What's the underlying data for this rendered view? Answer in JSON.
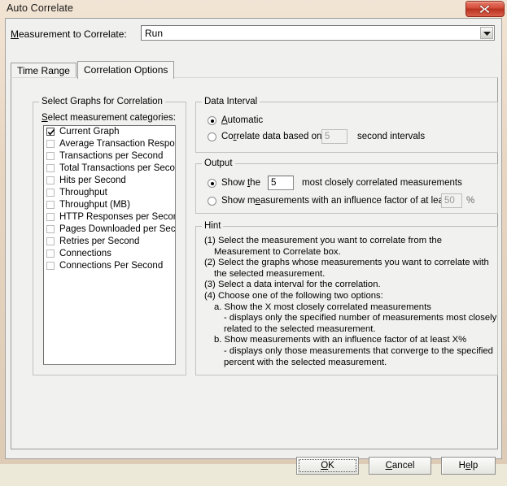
{
  "window": {
    "title": "Auto Correlate",
    "close_label": "X",
    "close_icon": "close-icon"
  },
  "measurement": {
    "label_prefix": "M",
    "label_rest": "easurement to Correlate:",
    "selected_value": "Run",
    "dropdown_icon": "chevron-down-icon"
  },
  "tabs": [
    {
      "label": "Time Range",
      "active": false
    },
    {
      "label": "Correlation Options",
      "active": true
    }
  ],
  "graphs_group": {
    "title": "Select Graphs for Correlation",
    "list_label_prefix": "S",
    "list_label_rest": "elect measurement categories:",
    "items": [
      {
        "label": "Current Graph",
        "checked": true
      },
      {
        "label": "Average Transaction Response Time",
        "checked": false
      },
      {
        "label": "Transactions per Second",
        "checked": false
      },
      {
        "label": "Total Transactions per Second",
        "checked": false
      },
      {
        "label": "Hits per Second",
        "checked": false
      },
      {
        "label": "Throughput",
        "checked": false
      },
      {
        "label": "Throughput (MB)",
        "checked": false
      },
      {
        "label": "HTTP Responses per Second",
        "checked": false
      },
      {
        "label": "Pages Downloaded per Second",
        "checked": false
      },
      {
        "label": "Retries per Second",
        "checked": false
      },
      {
        "label": "Connections",
        "checked": false
      },
      {
        "label": "Connections Per Second",
        "checked": false
      }
    ]
  },
  "data_interval": {
    "title": "Data Interval",
    "option_automatic": {
      "prefix": "A",
      "rest": "utomatic",
      "selected": true
    },
    "option_custom": {
      "prefix": "Co",
      "mnemonic": "r",
      "rest": "relate data based on",
      "selected": false
    },
    "interval_value": "5",
    "interval_suffix": "second intervals"
  },
  "output": {
    "title": "Output",
    "option_show_count": {
      "prefix": "Show ",
      "mnemonic": "t",
      "rest": "he",
      "selected": true
    },
    "count_value": "5",
    "count_suffix": "most closely correlated measurements",
    "option_show_influence": {
      "prefix": "Show m",
      "mnemonic": "e",
      "rest": "asurements with an influence factor of at least",
      "selected": false
    },
    "influence_value": "50",
    "influence_suffix": "%"
  },
  "hint": {
    "title": "Hint",
    "lines": [
      {
        "text": "(1) Select the measurement you want to correlate from the",
        "indent": 0
      },
      {
        "text": "Measurement to Correlate box.",
        "indent": 1
      },
      {
        "text": "(2) Select the graphs whose measurements you want to correlate with",
        "indent": 0
      },
      {
        "text": "the selected measurement.",
        "indent": 1
      },
      {
        "text": "(3) Select a data interval for the correlation.",
        "indent": 0
      },
      {
        "text": "(4) Choose one of the following two options:",
        "indent": 0
      },
      {
        "text": "a. Show the X most closely correlated measurements",
        "indent": 1
      },
      {
        "text": "- displays only the specified number of measurements most closely",
        "indent": 2
      },
      {
        "text": "related to the selected measurement.",
        "indent": 2
      },
      {
        "text": "b. Show measurements with an influence factor of at least X%",
        "indent": 1
      },
      {
        "text": "- displays only those measurements that converge to the specified",
        "indent": 2
      },
      {
        "text": "percent with the selected measurement.",
        "indent": 2
      }
    ]
  },
  "buttons": [
    {
      "prefix": "O",
      "mnemonic": "K",
      "rest": "",
      "name": "ok-button",
      "default": true
    },
    {
      "prefix": "",
      "mnemonic": "C",
      "rest": "ancel",
      "name": "cancel-button",
      "default": false
    },
    {
      "prefix": "H",
      "mnemonic": "e",
      "rest": "lp",
      "name": "help-button",
      "default": false
    }
  ],
  "colors": {
    "close_red": "#b93222",
    "window_chrome": "#e8d6c2",
    "dialog_face": "#f1f1ef"
  }
}
